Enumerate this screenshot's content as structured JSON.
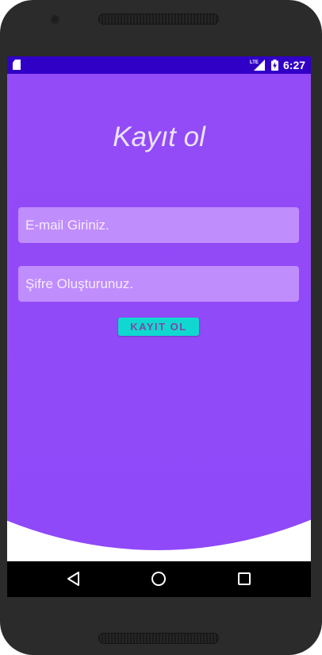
{
  "status_bar": {
    "network_label": "LTE",
    "time": "6:27",
    "background_color": "#3100c6"
  },
  "screen": {
    "title": "Kayıt ol",
    "email_field": {
      "placeholder": "E-mail Giriniz.",
      "value": ""
    },
    "password_field": {
      "placeholder": "Şifre Oluşturunuz.",
      "value": ""
    },
    "register_button_label": "KAYIT OL"
  },
  "icons": {
    "sd_card": "sd-card-icon",
    "signal": "lte-signal-icon",
    "battery": "battery-charging-icon",
    "back": "back-triangle-icon",
    "home": "home-circle-icon",
    "recents": "recents-square-icon"
  },
  "colors": {
    "background_purple": "#9b4ff5",
    "field_fill": "#c08dfd",
    "button_fill": "#10d8d0",
    "button_text": "#7b4aa6"
  }
}
